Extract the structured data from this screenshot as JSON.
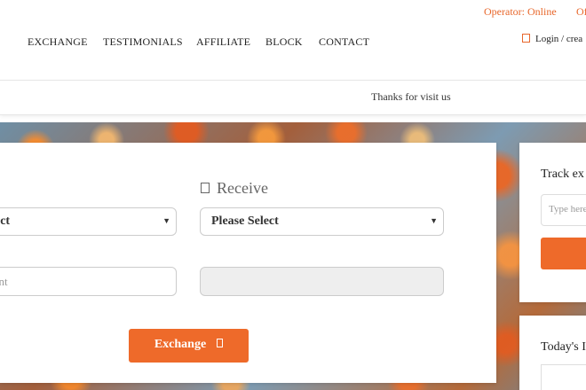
{
  "status": {
    "operator": "Operator: Online",
    "offline": "Of"
  },
  "nav": {
    "items": [
      "EXCHANGE",
      "TESTIMONIALS",
      "AFFILIATE",
      "BLOCK",
      "CONTACT"
    ],
    "login": "Login / crea"
  },
  "ticker": {
    "text": "Thanks for visit us"
  },
  "exchange": {
    "receive_heading": "Receive",
    "send_select": "ect",
    "receive_select": "Please Select",
    "send_amount_placeholder": "unt",
    "receive_amount_value": "",
    "button_label": "Exchange"
  },
  "track": {
    "title": "Track ex",
    "placeholder": "Type here"
  },
  "today": {
    "title": "Today's I"
  },
  "colors": {
    "accent": "#ee6a2a",
    "status_text": "#e8672b"
  },
  "icons": {
    "login": "user-icon",
    "receive": "download-icon",
    "exchange_button": "arrow-right-icon",
    "select_caret": "caret-down-icon"
  }
}
